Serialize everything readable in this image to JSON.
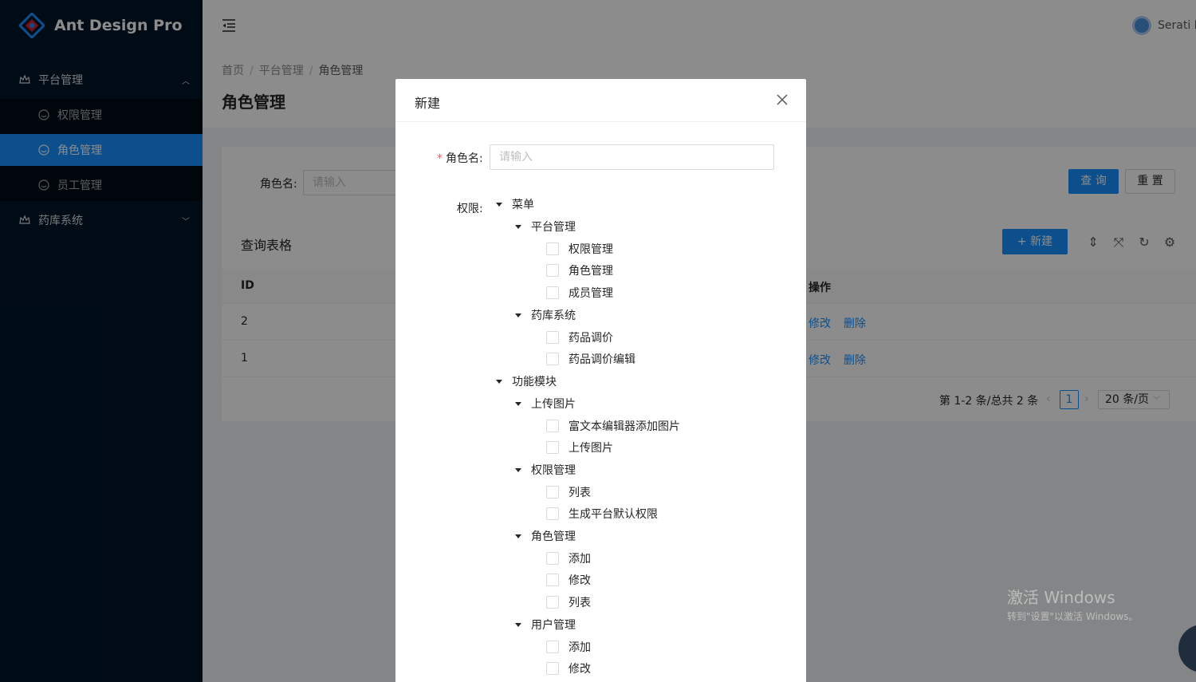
{
  "app": {
    "title": "Ant Design Pro"
  },
  "sidebar": {
    "groups": [
      {
        "label": "平台管理",
        "expanded": true,
        "items": [
          {
            "label": "权限管理"
          },
          {
            "label": "角色管理",
            "active": true
          },
          {
            "label": "员工管理"
          }
        ]
      },
      {
        "label": "药库系统",
        "expanded": false
      }
    ]
  },
  "header": {
    "user": "Serati M"
  },
  "breadcrumb": [
    "首页",
    "平台管理",
    "角色管理"
  ],
  "page": {
    "title": "角色管理"
  },
  "search": {
    "label": "角色名:",
    "placeholder": "请输入",
    "query_label": "查 询",
    "reset_label": "重 置"
  },
  "table": {
    "title": "查询表格",
    "new_label": "+ 新建",
    "columns": [
      "ID",
      "操作"
    ],
    "rows": [
      {
        "id": "2",
        "edit": "修改",
        "delete": "删除"
      },
      {
        "id": "1",
        "edit": "修改",
        "delete": "删除"
      }
    ],
    "pagination": {
      "summary": "第 1-2 条/总共 2 条",
      "current": "1",
      "page_size": "20 条/页"
    }
  },
  "modal": {
    "title": "新建",
    "name_label": "角色名:",
    "name_placeholder": "请输入",
    "perm_label": "权限:",
    "tree": {
      "menu": "菜单",
      "platform": "平台管理",
      "platform_items": [
        "权限管理",
        "角色管理",
        "成员管理"
      ],
      "pharmacy": "药库系统",
      "pharmacy_items": [
        "药品调价",
        "药品调价编辑"
      ],
      "modules": "功能模块",
      "upload": "上传图片",
      "upload_items": [
        "富文本编辑器添加图片",
        "上传图片"
      ],
      "perm": "权限管理",
      "perm_items": [
        "列表",
        "生成平台默认权限"
      ],
      "role": "角色管理",
      "role_items": [
        "添加",
        "修改",
        "列表"
      ],
      "user": "用户管理",
      "user_items": [
        "添加",
        "修改"
      ]
    }
  },
  "watermark": {
    "line1": "激活 Windows",
    "line2": "转到\"设置\"以激活 Windows。"
  },
  "colors": {
    "primary": "#1890ff",
    "sider": "#001529",
    "danger": "#ff4d4f"
  }
}
